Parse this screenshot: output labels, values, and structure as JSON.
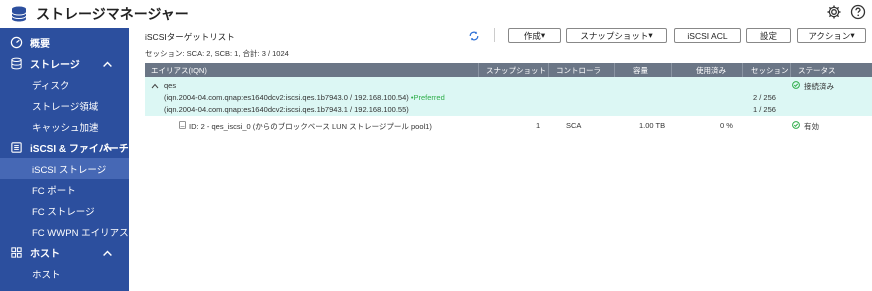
{
  "app": {
    "title": "ストレージマネージャー",
    "logo_icon": "database-icon",
    "settings_icon": "gear-icon",
    "help_icon": "help-icon"
  },
  "sidebar": {
    "overview": "概要",
    "storage": {
      "label": "ストレージ",
      "items": [
        "ディスク",
        "ストレージ領域",
        "キャッシュ加速"
      ]
    },
    "iscsi": {
      "label": "iSCSI & ファイバーチ",
      "items": [
        "iSCSI ストレージ",
        "FC ポート",
        "FC ストレージ",
        "FC WWPN エイリアス"
      ]
    },
    "host": {
      "label": "ホスト",
      "items": [
        "ホスト"
      ]
    },
    "active_item": "iSCSI ストレージ",
    "colors": {
      "bg": "#2c4f9e",
      "active": "#4668b5"
    }
  },
  "toolbar": {
    "title": "iSCSIターゲットリスト",
    "refresh_icon": "refresh-icon",
    "create": "作成",
    "snapshot": "スナップショット",
    "iscsi_acl": "iSCSI ACL",
    "settings": "設定",
    "action": "アクション"
  },
  "session_info": "セッション: SCA: 2, SCB: 1, 合計: 3 / 1024",
  "table": {
    "headers": [
      "エイリアス(IQN)",
      "スナップショット",
      "コントローラ",
      "容量",
      "使用済み",
      "セッション",
      "ステータス"
    ],
    "target": {
      "alias": "qes",
      "iqn1": "(iqn.2004-04.com.qnap:es1640dcv2:iscsi.qes.1b7943.0 / 192.168.100.54)",
      "preferred": "•Preferred",
      "iqn2": "(iqn.2004-04.com.qnap:es1640dcv2:iscsi.qes.1b7943.1 / 192.168.100.55)",
      "session1": "2 / 256",
      "session2": "1 / 256",
      "status": "接続済み"
    },
    "lun": {
      "name": "ID: 2 - qes_iscsi_0 (からのブロックベース LUN ストレージプール pool1)",
      "snapshot": "1",
      "controller": "SCA",
      "capacity": "1.00 TB",
      "used": "0 %",
      "status": "有効"
    },
    "colors": {
      "header_bg": "#6b7686",
      "group_bg": "#dcf7f4",
      "ok": "#2fae4a",
      "preferred": "#2fae4a"
    }
  }
}
